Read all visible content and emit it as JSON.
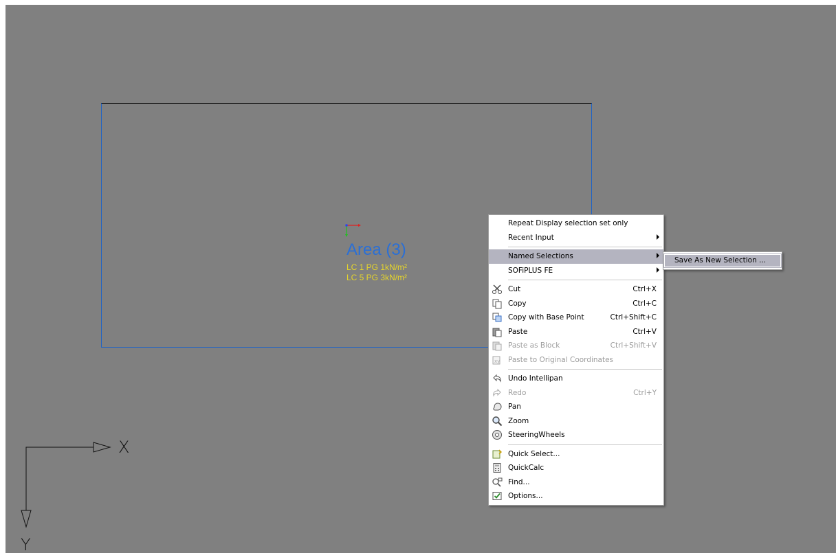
{
  "area": {
    "title": "Area (3)",
    "loads": [
      "LC 1 PG 1kN/m²",
      "LC 5 PG 3kN/m²"
    ]
  },
  "ucs": {
    "x_label": "X",
    "y_label": "Y"
  },
  "context_menu": {
    "repeat": "Repeat Display selection set only",
    "recent_input": "Recent Input",
    "named_selections": "Named Selections",
    "sofiplus": "SOFiPLUS FE",
    "cut": {
      "label": "Cut",
      "shortcut": "Ctrl+X"
    },
    "copy": {
      "label": "Copy",
      "shortcut": "Ctrl+C"
    },
    "copy_base": {
      "label": "Copy with Base Point",
      "shortcut": "Ctrl+Shift+C"
    },
    "paste": {
      "label": "Paste",
      "shortcut": "Ctrl+V"
    },
    "paste_block": {
      "label": "Paste as Block",
      "shortcut": "Ctrl+Shift+V"
    },
    "paste_orig": {
      "label": "Paste to Original Coordinates"
    },
    "undo": {
      "label": "Undo Intellipan"
    },
    "redo": {
      "label": "Redo",
      "shortcut": "Ctrl+Y"
    },
    "pan": {
      "label": "Pan"
    },
    "zoom": {
      "label": "Zoom"
    },
    "steering": {
      "label": "SteeringWheels"
    },
    "quick_select": {
      "label": "Quick Select..."
    },
    "quickcalc": {
      "label": "QuickCalc"
    },
    "find": {
      "label": "Find..."
    },
    "options": {
      "label": "Options..."
    }
  },
  "submenu": {
    "save_as_new": "Save As New Selection ..."
  }
}
